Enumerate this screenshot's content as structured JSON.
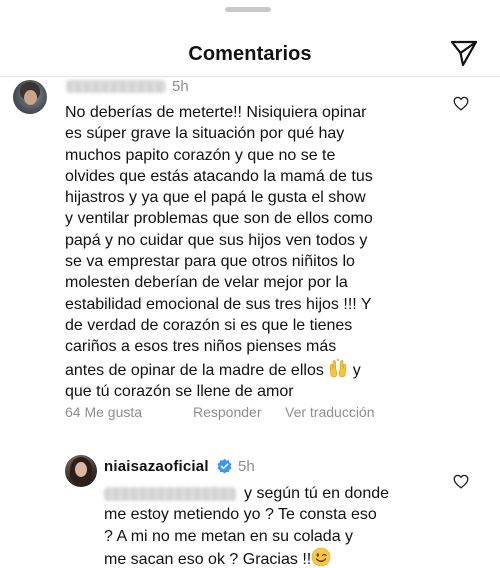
{
  "sheet": {
    "title": "Comentarios",
    "share_icon": "paper-plane-icon"
  },
  "comment_1": {
    "username_blurred": "tamborilero_01",
    "time": "5h",
    "lines": [
      "No deberías de meterte!! Nisiquiera opinar",
      "es súper grave  la situación por qué hay",
      "muchos papito corazón y que no se te",
      "olvides que estás atacando la mamá de tus",
      "hijastros y ya que el papá le gusta el show",
      "y ventilar problemas que son de ellos como",
      "papá y no cuidar que sus hijos ven todos y",
      "se va emprestar  para que otros niñitos lo",
      "molesten deberían de velar mejor por la",
      "estabilidad emocional de sus tres hijos !!! Y",
      "de verdad de corazón si es que le tienes",
      "cariños a esos tres niños pienses más",
      "antes de opinar de la madre de ellos",
      "que tú corazón se llene de amor"
    ],
    "line_13_suffix": "y",
    "emoji": "raising-hands-emoji",
    "likes": "64 Me gusta",
    "reply_label": "Responder",
    "translate_label": "Ver traducción",
    "heart_icon": "heart-outline-icon"
  },
  "reply_1": {
    "username": "niaisazaoficial",
    "verified_icon": "verified-badge-icon",
    "time": "5h",
    "mention_blurred": "@tamborilero_01",
    "lines": [
      "y según tú en donde",
      "me estoy metiendo yo ? Te consta eso",
      "? A mi no me metan en su colada y",
      "me sacan eso ok ? Gracias !!"
    ],
    "emoji": "winking-face-emoji",
    "heart_icon": "heart-outline-icon"
  },
  "colors": {
    "text": "#111111",
    "muted": "#8e8e8e",
    "verified": "#3897f0",
    "divider": "#e4e4e4"
  }
}
